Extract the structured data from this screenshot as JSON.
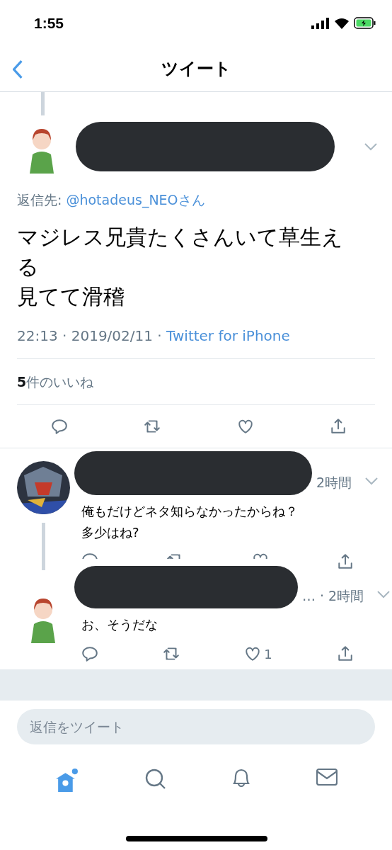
{
  "status_bar": {
    "time": "1:55"
  },
  "header": {
    "title": "ツイート"
  },
  "main_tweet": {
    "reply_to_label": "返信先: ",
    "reply_to_handle": "@hotadeus_NEOさん",
    "lines": [
      "マジレス兄貴たくさんいて草生える",
      "見てて滑稽"
    ],
    "timestamp": "22:13 · 2019/02/11 · ",
    "source": "Twitter for iPhone",
    "likes_count": "5",
    "likes_label": "件のいいね"
  },
  "replies": [
    {
      "time": "2時間",
      "lines": [
        "俺もだけどネタ知らなかったからね？",
        "多少はね?"
      ],
      "actions_covered": true,
      "thread_continues": true
    },
    {
      "time": "… · 2時間",
      "lines": [
        "お、そうだな"
      ],
      "like_count": "1",
      "actions_covered": false,
      "thread_continues": false
    }
  ],
  "reply_box": {
    "placeholder": "返信をツイート"
  },
  "tab_bar": [
    {
      "kind": "home",
      "selected": true
    },
    {
      "kind": "search",
      "selected": false
    },
    {
      "kind": "notifications",
      "selected": false
    },
    {
      "kind": "messages",
      "selected": false
    }
  ]
}
